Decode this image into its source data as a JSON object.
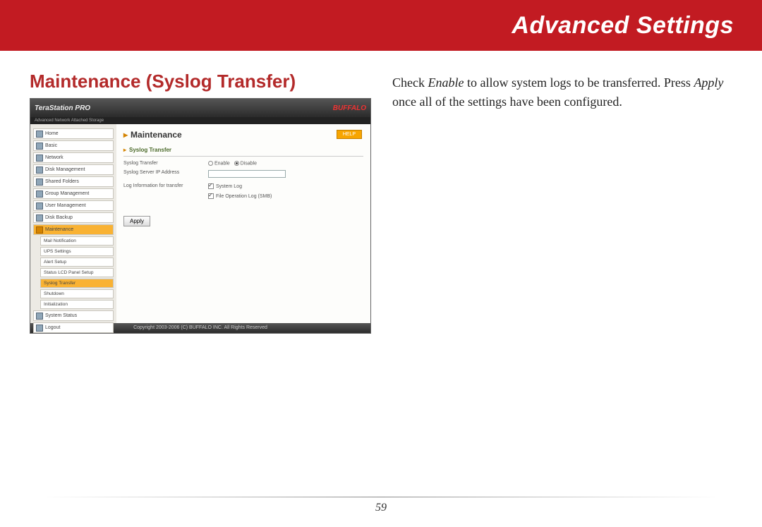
{
  "banner": {
    "title": "Advanced Settings"
  },
  "section": {
    "title": "Maintenance (Syslog Transfer)"
  },
  "instruction": {
    "pre": "Check ",
    "em1": "Enable",
    "mid": " to allow system logs to be transferred.  Press ",
    "em2": "Apply",
    "post": " once all of the settings have been configured."
  },
  "page_number": "59",
  "screenshot": {
    "product": "TeraStation PRO",
    "brand": "BUFFALO",
    "tagline": "Advanced Network Attached Storage",
    "nav": [
      "Home",
      "Basic",
      "Network",
      "Disk Management",
      "Shared Folders",
      "Group Management",
      "User Management",
      "Disk Backup",
      "Maintenance"
    ],
    "nav_active_index": 8,
    "subnav": [
      "Mail Notification",
      "UPS Settings",
      "Alert Setup",
      "Status LCD Panel Setup",
      "Syslog Transfer",
      "Shutdown",
      "Initialization"
    ],
    "subnav_selected_index": 4,
    "nav_tail": [
      "System Status",
      "Logout"
    ],
    "main": {
      "title": "Maintenance",
      "help_label": "HELP",
      "subsection": "Syslog Transfer",
      "row1_label": "Syslog Transfer",
      "row1_opt_enable": "Enable",
      "row1_opt_disable": "Disable",
      "row2_label": "Syslog Server IP Address",
      "row3_label": "Log Information for transfer",
      "row3_chk1": "System Log",
      "row3_chk2": "File Operation Log (SMB)",
      "apply_label": "Apply"
    },
    "footer": "Copyright 2003-2006 (C) BUFFALO INC. All Rights Reserved"
  }
}
